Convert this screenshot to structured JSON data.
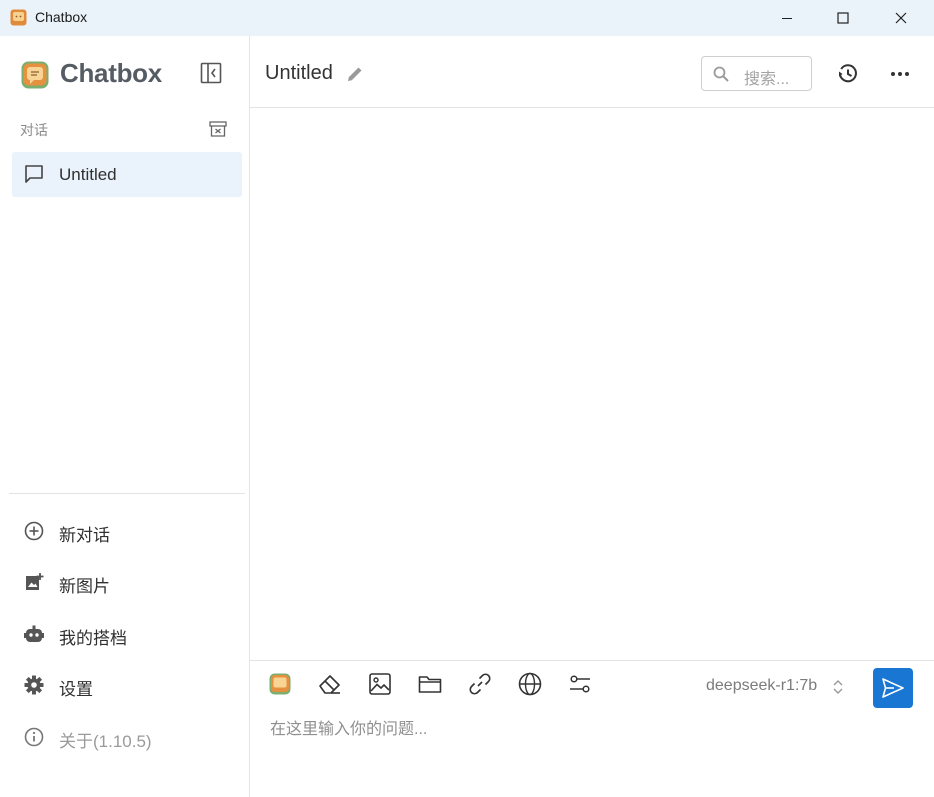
{
  "window": {
    "title": "Chatbox",
    "controls": [
      "minimize",
      "maximize",
      "close"
    ]
  },
  "sidebar": {
    "brand": "Chatbox",
    "section_label": "对话",
    "sessions": [
      {
        "title": "Untitled",
        "icon": "chat-bubble-icon",
        "selected": true
      }
    ],
    "menu": [
      {
        "label": "新对话",
        "icon": "add-circle-icon"
      },
      {
        "label": "新图片",
        "icon": "add-image-icon"
      },
      {
        "label": "我的搭档",
        "icon": "robot-icon"
      },
      {
        "label": "设置",
        "icon": "gear-icon"
      },
      {
        "label": "关于(1.10.5)",
        "icon": "info-icon"
      }
    ]
  },
  "header": {
    "title": "Untitled",
    "search_placeholder": "搜索..."
  },
  "composer": {
    "tools": [
      "chatbox-logo-icon",
      "eraser-icon",
      "image-icon",
      "folder-icon",
      "link-icon",
      "globe-icon",
      "sliders-icon"
    ],
    "model": "deepseek-r1:7b",
    "placeholder": "在这里输入你的问题..."
  },
  "colors": {
    "accent": "#1976d2",
    "selected_bg": "#eaf2fb",
    "titlebar_bg": "#eaf3f9",
    "brand_text": "#555c63"
  }
}
